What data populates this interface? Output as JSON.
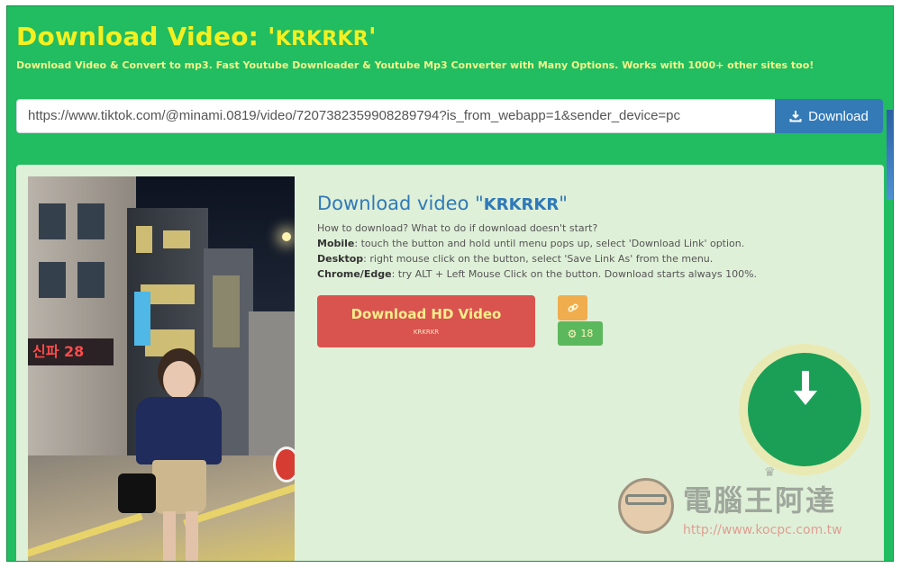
{
  "header": {
    "title_prefix": "Download Video: '",
    "video_name": "KRKRKR",
    "title_suffix": "'",
    "subtitle": "Download Video & Convert to mp3. Fast Youtube Downloader & Youtube Mp3 Converter with Many Options. Works with 1000+ other sites too!"
  },
  "search": {
    "url_value": "https://www.tiktok.com/@minami.0819/video/7207382359908289794?is_from_webapp=1&sender_device=pc",
    "button_label": "Download"
  },
  "result": {
    "title_prefix": "Download video \"",
    "video_name": "KRKRKR",
    "title_suffix": "\"",
    "how_line": "How to download? What to do if download doesn't start?",
    "mobile_label": "Mobile",
    "mobile_text": ": touch the button and hold until menu pops up, select 'Download Link' option.",
    "desktop_label": "Desktop",
    "desktop_text": ": right mouse click on the button, select 'Save Link As' from the menu.",
    "chrome_label": "Chrome/Edge",
    "chrome_text": ": try ALT + Left Mouse Click on the button. Download starts always 100%.",
    "hd_button_label": "Download HD Video",
    "hd_button_sublabel": "KRKRKR",
    "count_value": "18"
  },
  "thumbnail": {
    "sign_text": "신파 28"
  },
  "watermark": {
    "title": "電腦王阿達",
    "url": "http://www.kocpc.com.tw"
  },
  "colors": {
    "page_bg": "#21bd60",
    "title_yellow": "#f4f020",
    "download_blue": "#337ab7",
    "panel_bg": "#dff0d8",
    "hd_red": "#d9534f",
    "link_orange": "#f0ad4e",
    "count_green": "#5cb85c"
  },
  "icons": {
    "download_button_icon": "download-icon",
    "link_button_icon": "link-icon",
    "count_button_icon": "gear-icon",
    "overlay_icon": "download-arrow-icon"
  }
}
